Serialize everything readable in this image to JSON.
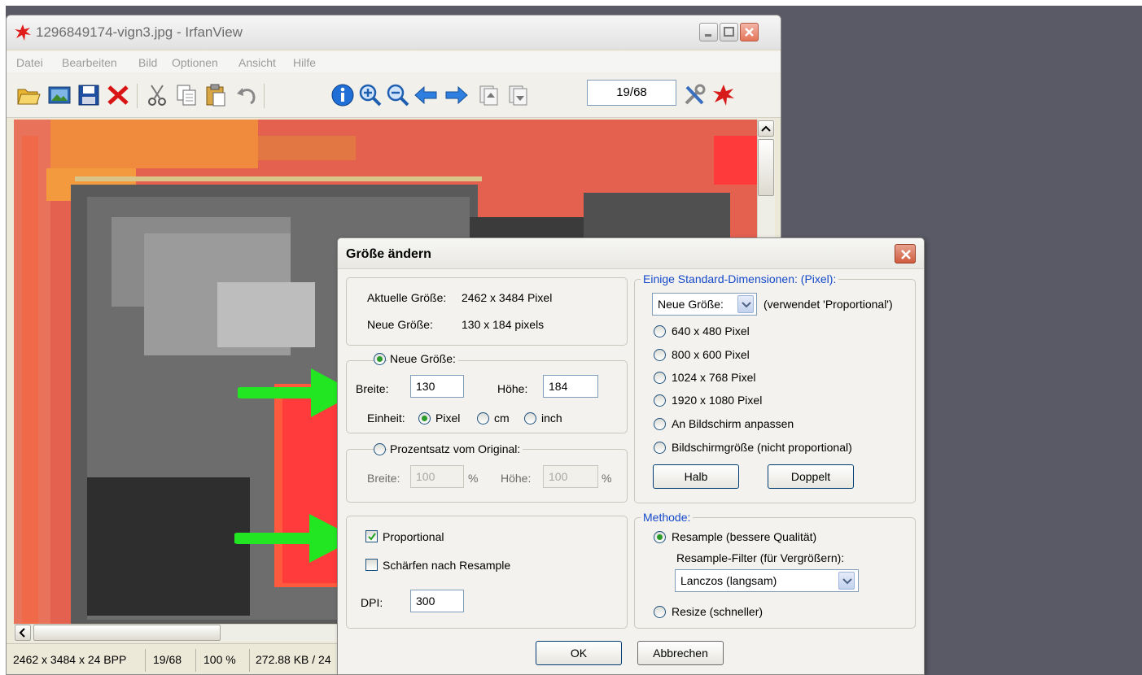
{
  "main_window": {
    "title": "1296849174-vign3.jpg - IrfanView",
    "menu": [
      "Datei",
      "Bearbeiten",
      "Bild",
      "Optionen",
      "Ansicht",
      "Hilfe"
    ],
    "counter": "19/68",
    "status": {
      "dims": "2462 x 3484 x 24 BPP",
      "index": "19/68",
      "zoom": "100 %",
      "size": "272.88 KB / 24"
    }
  },
  "dialog": {
    "title": "Größe ändern",
    "current_label": "Aktuelle Größe:",
    "current_value": "2462  x  3484  Pixel",
    "new_label": "Neue Größe:",
    "new_value": "130  x  184  pixels",
    "new_size_radio": "Neue Größe:",
    "width_label": "Breite:",
    "width_value": "130",
    "height_label": "Höhe:",
    "height_value": "184",
    "unit_label": "Einheit:",
    "unit_pixel": "Pixel",
    "unit_cm": "cm",
    "unit_inch": "inch",
    "percent_radio": "Prozentsatz vom Original:",
    "pct_width_label": "Breite:",
    "pct_width_value": "100",
    "pct_height_label": "Höhe:",
    "pct_height_value": "100",
    "pct_sign": "%",
    "proportional": "Proportional",
    "sharpen": "Schärfen nach Resample",
    "dpi_label": "DPI:",
    "dpi_value": "300",
    "std_legend": "Einige Standard-Dimensionen: (Pixel):",
    "std_select": "Neue Größe:",
    "std_note": "(verwendet 'Proportional')",
    "std_options": [
      "640 x 480 Pixel",
      "800 x 600 Pixel",
      "1024 x 768 Pixel",
      "1920 x 1080 Pixel",
      "An Bildschirm anpassen",
      "Bildschirmgröße (nicht proportional)"
    ],
    "half_button": "Halb",
    "double_button": "Doppelt",
    "method_legend": "Methode:",
    "resample": "Resample (bessere Qualität)",
    "filter_label": "Resample-Filter (für Vergrößern):",
    "filter_value": "Lanczos (langsam)",
    "resize": "Resize (schneller)",
    "ok": "OK",
    "cancel": "Abbrechen"
  },
  "colors": {
    "image_red": "#e4604f",
    "highlight_red": "#ff3b3b",
    "arrow_green": "#22e622",
    "legend_blue": "#1549c9"
  }
}
